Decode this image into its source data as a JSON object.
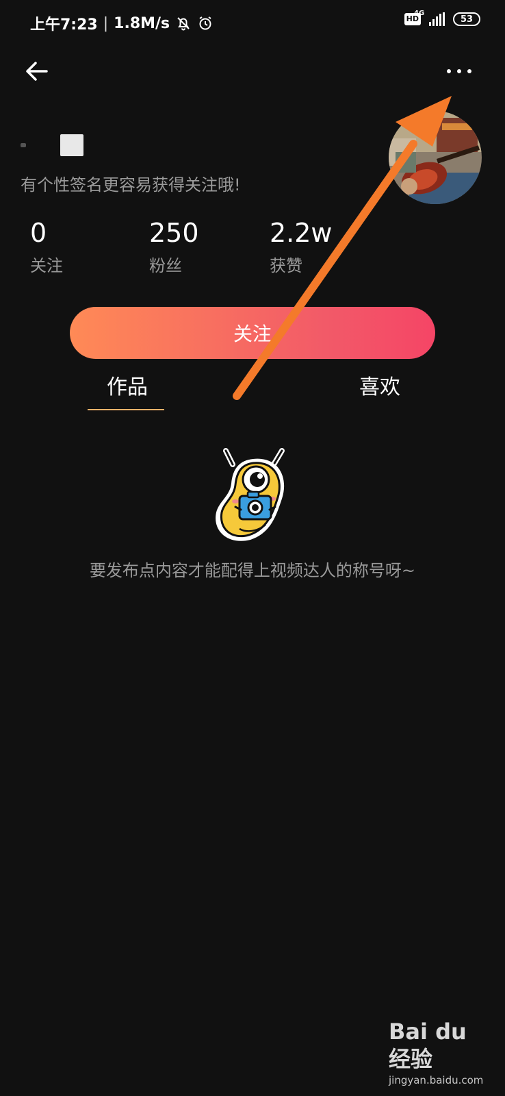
{
  "status_bar": {
    "time": "上午7:23",
    "net_speed": "1.8M/s",
    "hd": "HD",
    "network": "4G",
    "battery": "53"
  },
  "header": {
    "back_icon": "arrow-left-icon",
    "more_icon": "more-dots-icon"
  },
  "profile": {
    "signature": "有个性签名更容易获得关注哦!",
    "stats": [
      {
        "value": "0",
        "label": "关注"
      },
      {
        "value": "250",
        "label": "粉丝"
      },
      {
        "value": "2.2w",
        "label": "获赞"
      }
    ],
    "follow_label": "关注"
  },
  "tabs": [
    {
      "label": "作品",
      "active": true
    },
    {
      "label": "喜欢",
      "active": false
    }
  ],
  "empty_state": {
    "icon": "mascot-camera-icon",
    "text": "要发布点内容才能配得上视频达人的称号呀~"
  },
  "watermark": {
    "logo": "Bai du 经验",
    "url": "jingyan.baidu.com"
  },
  "colors": {
    "background": "#111111",
    "follow_gradient_start": "#ff8a56",
    "follow_gradient_end": "#f54566",
    "tab_underline": "#ffb36a",
    "annotation_arrow": "#f47a2a"
  }
}
